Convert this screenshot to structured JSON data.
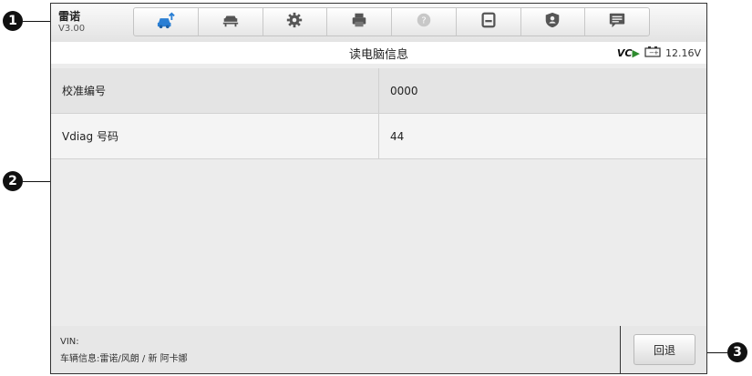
{
  "callouts": [
    "1",
    "2",
    "3"
  ],
  "header": {
    "app_name": "雷诺",
    "version": "V3.00",
    "tools": [
      {
        "icon": "vehicle-upload-icon"
      },
      {
        "icon": "car-lift-icon"
      },
      {
        "icon": "gear-icon"
      },
      {
        "icon": "printer-icon"
      },
      {
        "icon": "help-icon"
      },
      {
        "icon": "save-icon"
      },
      {
        "icon": "shield-user-icon"
      },
      {
        "icon": "message-icon"
      }
    ]
  },
  "title": "读电脑信息",
  "status": {
    "vci_label": "VC",
    "battery_voltage": "12.16V",
    "accent_color": "#2e8b2e"
  },
  "table": {
    "rows": [
      {
        "name": "校准编号",
        "value": "0000"
      },
      {
        "name": "Vdiag 号码",
        "value": "44"
      }
    ]
  },
  "footer": {
    "vin_label": "VIN:",
    "vehicle_info": "车辆信息:雷诺/风朗 / 新 阿卡娜",
    "back_label": "回退"
  }
}
